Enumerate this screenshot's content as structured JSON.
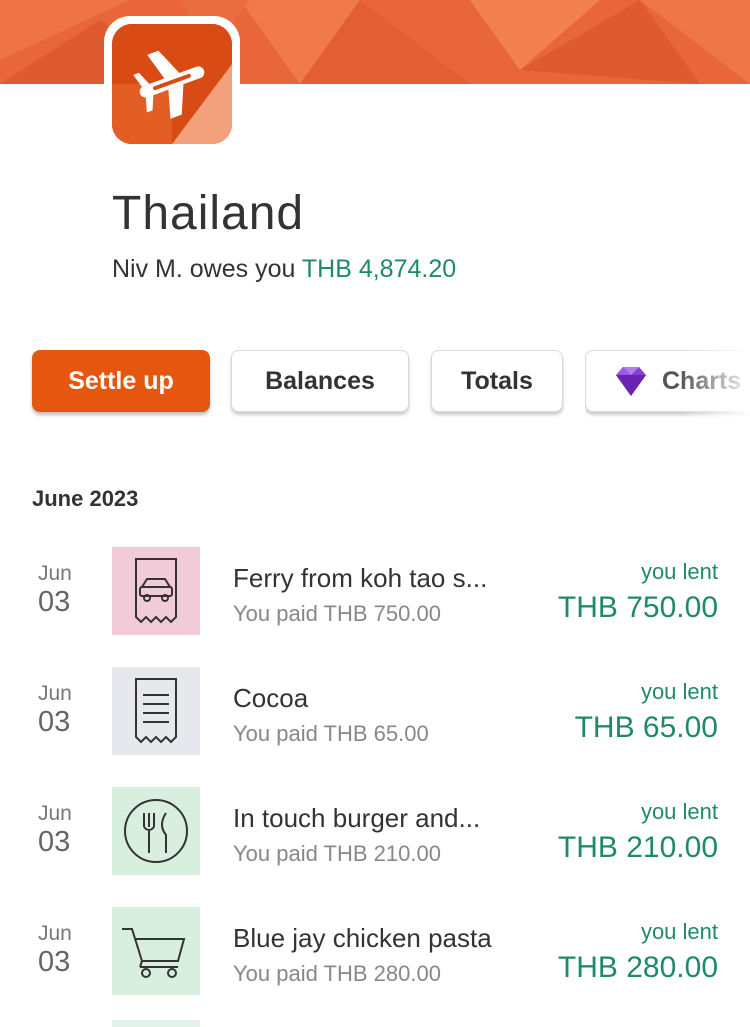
{
  "group": {
    "name": "Thailand",
    "balance_prefix": "Niv M. owes you",
    "balance_amount": "THB 4,874.20"
  },
  "actions": {
    "settle_up": "Settle up",
    "balances": "Balances",
    "totals": "Totals",
    "charts": "Charts"
  },
  "section": {
    "header": "June 2023"
  },
  "expenses": [
    {
      "month": "Jun",
      "day": "03",
      "icon": "car-receipt-icon",
      "description": "Ferry from koh tao s...",
      "paid": "You paid THB 750.00",
      "status": "you lent",
      "amount": "THB 750.00"
    },
    {
      "month": "Jun",
      "day": "03",
      "icon": "receipt-icon",
      "description": "Cocoa",
      "paid": "You paid THB 65.00",
      "status": "you lent",
      "amount": "THB 65.00"
    },
    {
      "month": "Jun",
      "day": "03",
      "icon": "dining-icon",
      "description": "In touch burger and...",
      "paid": "You paid THB 210.00",
      "status": "you lent",
      "amount": "THB 210.00"
    },
    {
      "month": "Jun",
      "day": "03",
      "icon": "shopping-cart-icon",
      "description": "Blue jay chicken pasta",
      "paid": "You paid THB 280.00",
      "status": "you lent",
      "amount": "THB 280.00"
    }
  ],
  "colors": {
    "brand_orange": "#e5560f",
    "positive_green": "#1e8a6a",
    "transport_bg": "#f2cbd8",
    "general_bg": "#e6e8ee",
    "food_bg": "#d8eedf",
    "grocery_bg": "#d8eedf"
  }
}
